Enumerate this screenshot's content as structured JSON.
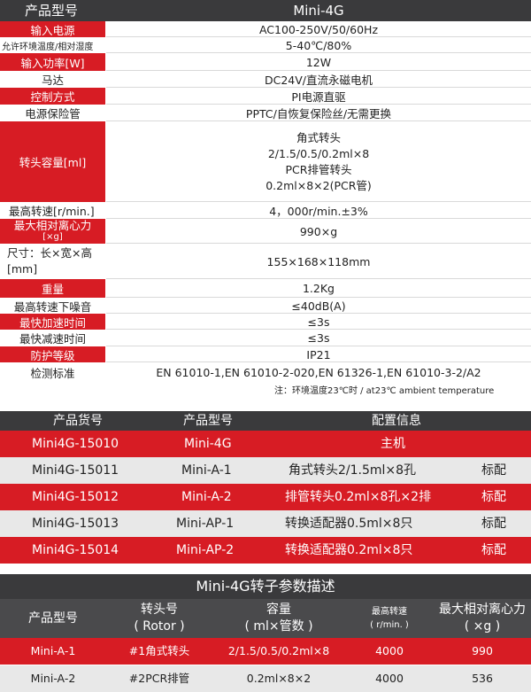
{
  "spec": {
    "header": {
      "label": "产品型号",
      "value": "Mini-4G"
    },
    "rows": [
      {
        "label": "输入电源",
        "value": "AC100-250V/50/60Hz"
      },
      {
        "label": "允许环境温度/相对湿度",
        "value": "5-40℃/80%"
      },
      {
        "label": "输入功率[W]",
        "value": "12W"
      },
      {
        "label": "马达",
        "value": "DC24V/直流永磁电机"
      },
      {
        "label": "控制方式",
        "value": "PI电源直驱"
      },
      {
        "label": "电源保险管",
        "value": "PPTC/自恢复保险丝/无需更换"
      },
      {
        "label": "转头容量[ml]",
        "lines": [
          "角式转头",
          "2/1.5/0.5/0.2ml×8",
          "PCR排管转头",
          "0.2ml×8×2(PCR管)"
        ]
      },
      {
        "label": "最高转速[r/min.]",
        "value": "4，000r/min.±3%"
      },
      {
        "label_lines": [
          "最大相对离心力",
          "[×g]"
        ],
        "value": "990×g"
      },
      {
        "label_lines": [
          "尺寸：长×宽×高",
          "[mm]"
        ],
        "value": "155×168×118mm"
      },
      {
        "label": "重量",
        "value": "1.2Kg"
      },
      {
        "label": "最高转速下噪音",
        "value": "≤40dB(A)"
      },
      {
        "label": "最快加速时间",
        "value": "≤3s"
      },
      {
        "label": "最快减速时间",
        "value": "≤3s"
      },
      {
        "label": "防护等级",
        "value": "IP21"
      },
      {
        "label": "检测标准",
        "value": "EN 61010-1,EN 61010-2-020,EN 61326-1,EN 61010-3-2/A2"
      }
    ],
    "note": "注：环境温度23℃时 / at23℃ ambient temperature"
  },
  "config": {
    "headers": [
      "产品货号",
      "产品型号",
      "配置信息"
    ],
    "rows": [
      {
        "sku": "Mini4G-15010",
        "model": "Mini-4G",
        "info": "主机",
        "tag": ""
      },
      {
        "sku": "Mini4G-15011",
        "model": "Mini-A-1",
        "info": "角式转头2/1.5ml×8孔",
        "tag": "标配"
      },
      {
        "sku": "Mini4G-15012",
        "model": "Mini-A-2",
        "info": "排管转头0.2ml×8孔×2排",
        "tag": "标配"
      },
      {
        "sku": "Mini4G-15013",
        "model": "Mini-AP-1",
        "info": "转换适配器0.5ml×8只",
        "tag": "标配"
      },
      {
        "sku": "Mini4G-15014",
        "model": "Mini-AP-2",
        "info": "转换适配器0.2ml×8只",
        "tag": "标配"
      }
    ]
  },
  "rotor": {
    "title": "Mini-4G转子参数描述",
    "headers": [
      {
        "main": "产品型号"
      },
      {
        "main": "转头号",
        "sub": "( Rotor )"
      },
      {
        "main": "容量",
        "sub": "( ml×管数 )"
      },
      {
        "small": "最高转速",
        "small_sub": "( r/min. )"
      },
      {
        "main": "最大相对离心力",
        "sub": "( ×g )"
      }
    ],
    "rows": [
      {
        "model": "Mini-A-1",
        "rotor": "#1角式转头",
        "capacity": "2/1.5/0.5/0.2ml×8",
        "speed": "4000",
        "rcf": "990"
      },
      {
        "model": "Mini-A-2",
        "rotor": "#2PCR排管",
        "capacity": "0.2ml×8×2",
        "speed": "4000",
        "rcf": "536"
      }
    ]
  },
  "colors": {
    "red": "#d71c24",
    "dark": "#3a3a3c",
    "gray": "#e8e8e8"
  }
}
